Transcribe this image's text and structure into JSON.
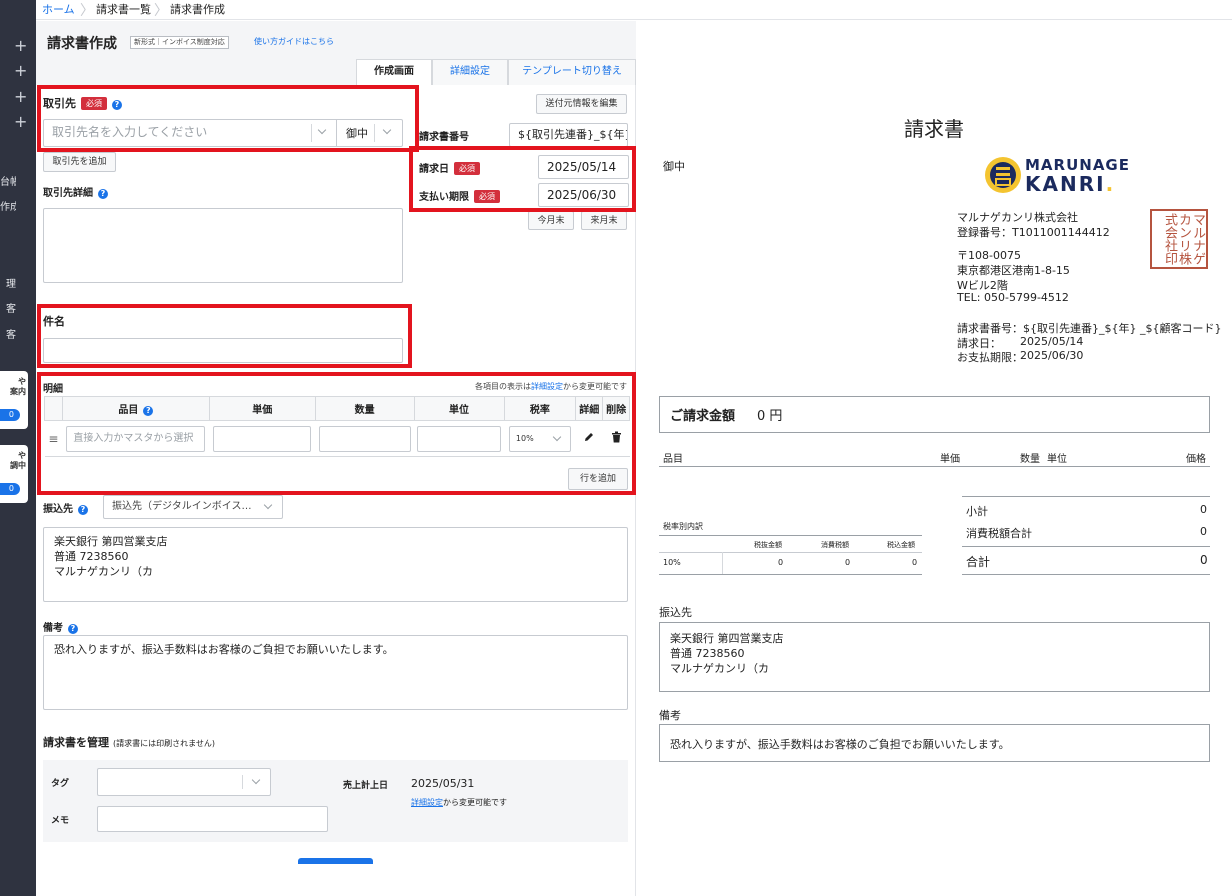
{
  "breadcrumb": {
    "home": "ホーム",
    "list": "請求書一覧",
    "current": "請求書作成"
  },
  "sidebar": {
    "texts": [
      "台帳",
      "作成",
      "理",
      "客",
      "客"
    ],
    "cards": [
      {
        "text": "や\n案内",
        "badge": "0"
      },
      {
        "text": "や\n調中",
        "badge": "0"
      }
    ]
  },
  "header": {
    "title": "請求書作成",
    "badge": "新形式｜インボイス制度対応",
    "guide_link": "使い方ガイドはこちら"
  },
  "tabs": [
    {
      "label": "作成画面"
    },
    {
      "label": "詳細設定"
    },
    {
      "label": "テンプレート切り替え"
    }
  ],
  "form": {
    "client": {
      "label": "取引先",
      "required": "必須",
      "placeholder": "取引先名を入力してください",
      "honorific": "御中",
      "add_button": "取引先を追加"
    },
    "sender_edit_button": "送付元情報を編集",
    "invoice_number": {
      "label": "請求書番号",
      "value": "${取引先連番}_${年}"
    },
    "invoice_date": {
      "label": "請求日",
      "required": "必須",
      "value": "2025/05/14"
    },
    "due_date": {
      "label": "支払い期限",
      "required": "必須",
      "value": "2025/06/30"
    },
    "month_end_buttons": [
      "今月末",
      "来月末"
    ],
    "client_detail": {
      "label": "取引先詳細"
    },
    "subject": {
      "label": "件名",
      "value": ""
    },
    "details": {
      "label": "明細",
      "note_prefix": "各項目の表示は",
      "note_link": "詳細設定",
      "note_suffix": "から変更可能です",
      "columns": [
        "品目",
        "単価",
        "数量",
        "単位",
        "税率",
        "詳細",
        "削除"
      ],
      "row": {
        "item_placeholder": "直接入力かマスタから選択",
        "tax_rate": "10%"
      },
      "add_row_button": "行を追加"
    },
    "bank": {
      "label": "振込先",
      "select_value": "振込先（デジタルインボイス…",
      "text": "楽天銀行 第四営業支店\n普通 7238560\nマルナゲカンリ（カ"
    },
    "notes": {
      "label": "備考",
      "text": "恐れ入りますが、振込手数料はお客様のご負担でお願いいたします。"
    },
    "manage": {
      "label": "請求書を管理",
      "sublabel": "(請求書には印刷されません)",
      "tag_label": "タグ",
      "memo_label": "メモ",
      "sales_date_label": "売上計上日",
      "sales_date": "2025/05/31",
      "link_text": "詳細設定",
      "link_suffix": "から変更可能です"
    }
  },
  "preview": {
    "title": "請求書",
    "honorific": "御中",
    "logo": {
      "line1": "MARUNAGE",
      "line2": "KANRI"
    },
    "seal": "マルナゲカンリ株式会社印",
    "company": "マルナゲカンリ株式会社",
    "registration": "登録番号：T1011001144412",
    "postal": "〒108-0075",
    "address1": "東京都港区港南1-8-15",
    "address2": "Wビル2階",
    "tel": "TEL: 050-5799-4512",
    "invoice_no_line": "請求書番号：${取引先連番}_${年} _${顧客コード}",
    "date_label": "請求日：",
    "date_value": "2025/05/14",
    "due_label": "お支払期限：",
    "due_value": "2025/06/30",
    "amount_label": "ご請求金額",
    "amount_value": "0 円",
    "table_headers": {
      "item": "品目",
      "price": "単価",
      "qty": "数量",
      "unit": "単位",
      "amount": "価格"
    },
    "tax_breakdown": {
      "title": "税率別内訳",
      "headers": [
        "税抜金額",
        "消費税額",
        "税込金額"
      ],
      "rate": "10%",
      "values": [
        "0",
        "0",
        "0"
      ]
    },
    "totals": [
      {
        "label": "小計",
        "value": "0"
      },
      {
        "label": "消費税額合計",
        "value": "0"
      },
      {
        "label": "合計",
        "value": "0"
      }
    ],
    "bank_label": "振込先",
    "bank_text": "楽天銀行 第四営業支店\n普通 7238560\nマルナゲカンリ（カ",
    "notes_label": "備考",
    "notes_text": "恐れ入りますが、振込手数料はお客様のご負担でお願いいたします。"
  },
  "colors": {
    "accent": "#1a73e8",
    "required": "#d32f3c",
    "highlight": "#e3141e",
    "sidebar": "#2f3340"
  }
}
